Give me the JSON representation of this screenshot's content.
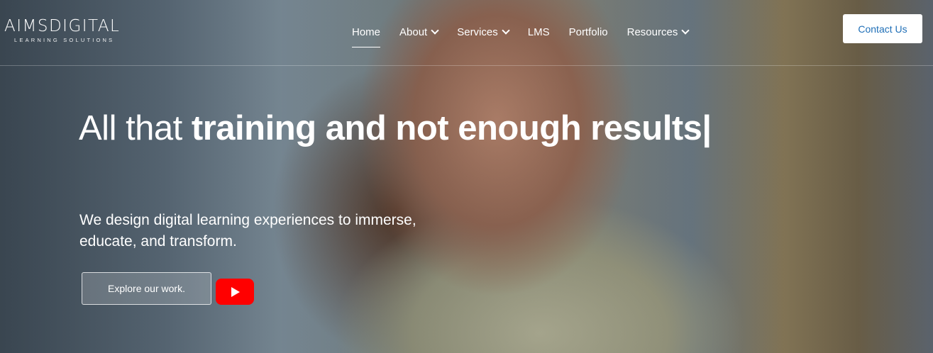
{
  "brand": {
    "name": "AIMSDIGITAL",
    "tagline": "LEARNING SOLUTIONS"
  },
  "nav": [
    {
      "label": "Home",
      "active": true,
      "dropdown": false
    },
    {
      "label": "About",
      "active": false,
      "dropdown": true
    },
    {
      "label": "Services",
      "active": false,
      "dropdown": true
    },
    {
      "label": "LMS",
      "active": false,
      "dropdown": false
    },
    {
      "label": "Portfolio",
      "active": false,
      "dropdown": false
    },
    {
      "label": "Resources",
      "active": false,
      "dropdown": true
    }
  ],
  "cta": {
    "contact_label": "Contact Us"
  },
  "hero": {
    "headline_thin": "All that ",
    "headline_bold": "training and not enough results|",
    "subheading": "We design digital learning experiences to immerse, educate, and transform.",
    "explore_label": "Explore our work.",
    "video_icon": "youtube-play-icon"
  },
  "colors": {
    "accent": "#1f6fb7",
    "youtube": "#ff0000",
    "text": "#ffffff"
  }
}
